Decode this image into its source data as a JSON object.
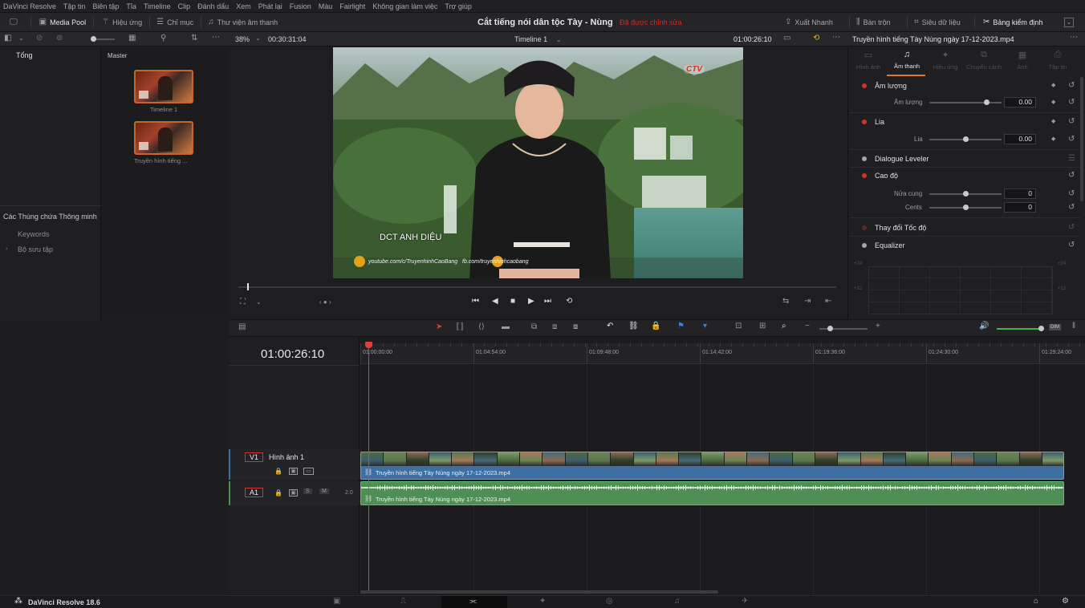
{
  "menu": [
    "DaVinci Resolve",
    "Tập tin",
    "Biên tập",
    "Tỉa",
    "Timeline",
    "Clip",
    "Đánh dấu",
    "Xem",
    "Phát lại",
    "Fusion",
    "Màu",
    "Fairlight",
    "Không gian làm việc",
    "Trợ giúp"
  ],
  "toolbar": {
    "media_pool": "Media Pool",
    "effects": "Hiệu ứng",
    "index": "Chỉ mục",
    "sound_library": "Thư viện âm thanh",
    "project_title": "Cắt tiếng nói dân tộc Tày - Nùng",
    "edited_status": "Đã được chỉnh sửa",
    "quick_export": "Xuất Nhanh",
    "mixer": "Bàn trộn",
    "metadata": "Siêu dữ liệu",
    "inspector": "Bảng kiểm định"
  },
  "subbar": {
    "zoom": "38%",
    "source_tc": "00:30:31:04",
    "timeline_name": "Timeline 1",
    "record_tc": "01:00:26:10",
    "clip_name": "Truyền hình tiếng Tày Nùng ngày 17-12-2023.mp4"
  },
  "left_panel": {
    "root_bin": "Tổng",
    "smart_bins_header": "Các Thùng chứa Thông minh",
    "keywords": "Keywords",
    "collections": "Bộ sưu tập"
  },
  "media_pool": {
    "header": "Master",
    "items": [
      {
        "label": "Timeline 1"
      },
      {
        "label": "Truyền hình tiếng ..."
      }
    ]
  },
  "viewer": {
    "lower_third": "DCT ANH DIỆU",
    "channel_logo": "CTV",
    "social_text": "youtube.com/c/TruyenhinhCaoBang   fb.com/truyenhinhcaobang"
  },
  "inspector": {
    "tabs": [
      "Hình ảnh",
      "Âm thanh",
      "Hiệu ứng",
      "Chuyển cảnh",
      "Ảnh",
      "Tập tin"
    ],
    "active_tab": "Âm thanh",
    "sections": {
      "volume_title": "Âm lượng",
      "volume_label": "Âm lượng",
      "volume_value": "0.00",
      "pan_title": "Lia",
      "pan_label": "Lia",
      "pan_value": "0.00",
      "dialogue_leveler": "Dialogue Leveler",
      "pitch_title": "Cao độ",
      "semitones_label": "Nửa cung",
      "semitones_value": "0",
      "cents_label": "Cents",
      "cents_value": "0",
      "speed_change": "Thay đổi Tốc độ",
      "equalizer": "Equalizer",
      "eq_ticks": [
        "+24",
        "+12",
        "+24",
        "+12"
      ]
    }
  },
  "timeline": {
    "timecode": "01:00:26:10",
    "ruler": [
      "01:00:00:00",
      "01:04:54:00",
      "01:09:48:00",
      "01:14:42:00",
      "01:19:36:00",
      "01:24:30:00",
      "01:29:24:00"
    ],
    "video_track": {
      "id": "V1",
      "name": "Hình ảnh 1",
      "clip": "Truyền hình tiếng Tày Nùng ngày 17-12-2023.mp4"
    },
    "audio_track": {
      "id": "A1",
      "channels": "2.0",
      "clip": "Truyền hình tiếng Tày Nùng ngày 17-12-2023.mp4",
      "solo": "S",
      "mute": "M"
    },
    "volume_meter_label": "DIM"
  },
  "app": {
    "version": "DaVinci Resolve 18.6"
  },
  "colors": {
    "accent_red": "#d0342c",
    "video_clip": "#3f6ea3",
    "audio_clip": "#4f8f55",
    "playhead": "#e0403a",
    "active_tab": "#e07a2f"
  }
}
